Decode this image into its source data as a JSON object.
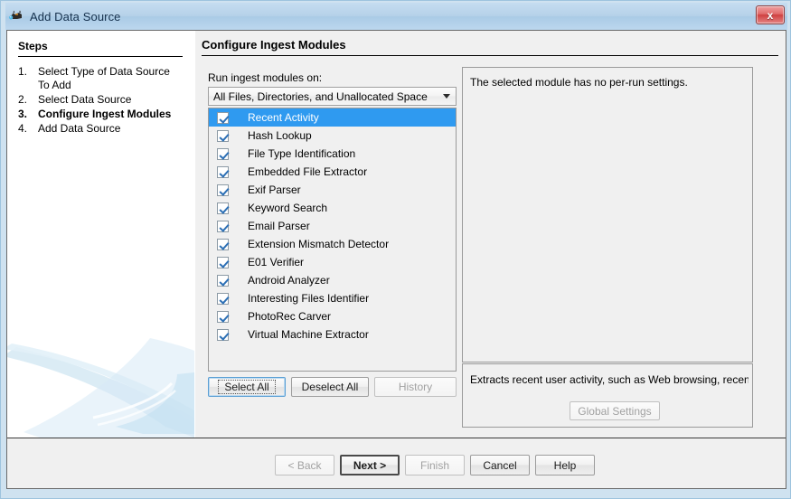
{
  "window": {
    "title": "Add Data Source",
    "app_icon": "autopsy-icon",
    "close_label": "x"
  },
  "sidebar": {
    "heading": "Steps",
    "steps": [
      {
        "num": "1.",
        "label": "Select Type of Data Source To Add",
        "current": false
      },
      {
        "num": "2.",
        "label": "Select Data Source",
        "current": false
      },
      {
        "num": "3.",
        "label": "Configure Ingest Modules",
        "current": true
      },
      {
        "num": "4.",
        "label": "Add Data Source",
        "current": false
      }
    ]
  },
  "main": {
    "title": "Configure Ingest Modules",
    "run_on_label": "Run ingest modules on:",
    "scope_combo": {
      "value": "All Files, Directories, and Unallocated Space",
      "arrow_icon": "chevron-down-icon"
    },
    "modules": [
      {
        "label": "Recent Activity",
        "checked": true,
        "selected": true
      },
      {
        "label": "Hash Lookup",
        "checked": true,
        "selected": false
      },
      {
        "label": "File Type Identification",
        "checked": true,
        "selected": false
      },
      {
        "label": "Embedded File Extractor",
        "checked": true,
        "selected": false
      },
      {
        "label": "Exif Parser",
        "checked": true,
        "selected": false
      },
      {
        "label": "Keyword Search",
        "checked": true,
        "selected": false
      },
      {
        "label": "Email Parser",
        "checked": true,
        "selected": false
      },
      {
        "label": "Extension Mismatch Detector",
        "checked": true,
        "selected": false
      },
      {
        "label": "E01 Verifier",
        "checked": true,
        "selected": false
      },
      {
        "label": "Android Analyzer",
        "checked": true,
        "selected": false
      },
      {
        "label": "Interesting Files Identifier",
        "checked": true,
        "selected": false
      },
      {
        "label": "PhotoRec Carver",
        "checked": true,
        "selected": false
      },
      {
        "label": "Virtual Machine Extractor",
        "checked": true,
        "selected": false
      }
    ],
    "list_buttons": {
      "select_all": "Select All",
      "deselect_all": "Deselect All",
      "history": "History"
    },
    "settings_panel_text": "The selected module has no per-run settings.",
    "description_text": "Extracts recent user activity, such as Web browsing, recentl...",
    "global_settings_label": "Global Settings"
  },
  "footer": {
    "back": "< Back",
    "next": "Next >",
    "finish": "Finish",
    "cancel": "Cancel",
    "help": "Help"
  },
  "colors": {
    "selection_blue": "#2f9af0",
    "titlebar_blue": "#b6d2e9",
    "close_red": "#cf4040",
    "dialog_gray": "#f0f0f0"
  }
}
